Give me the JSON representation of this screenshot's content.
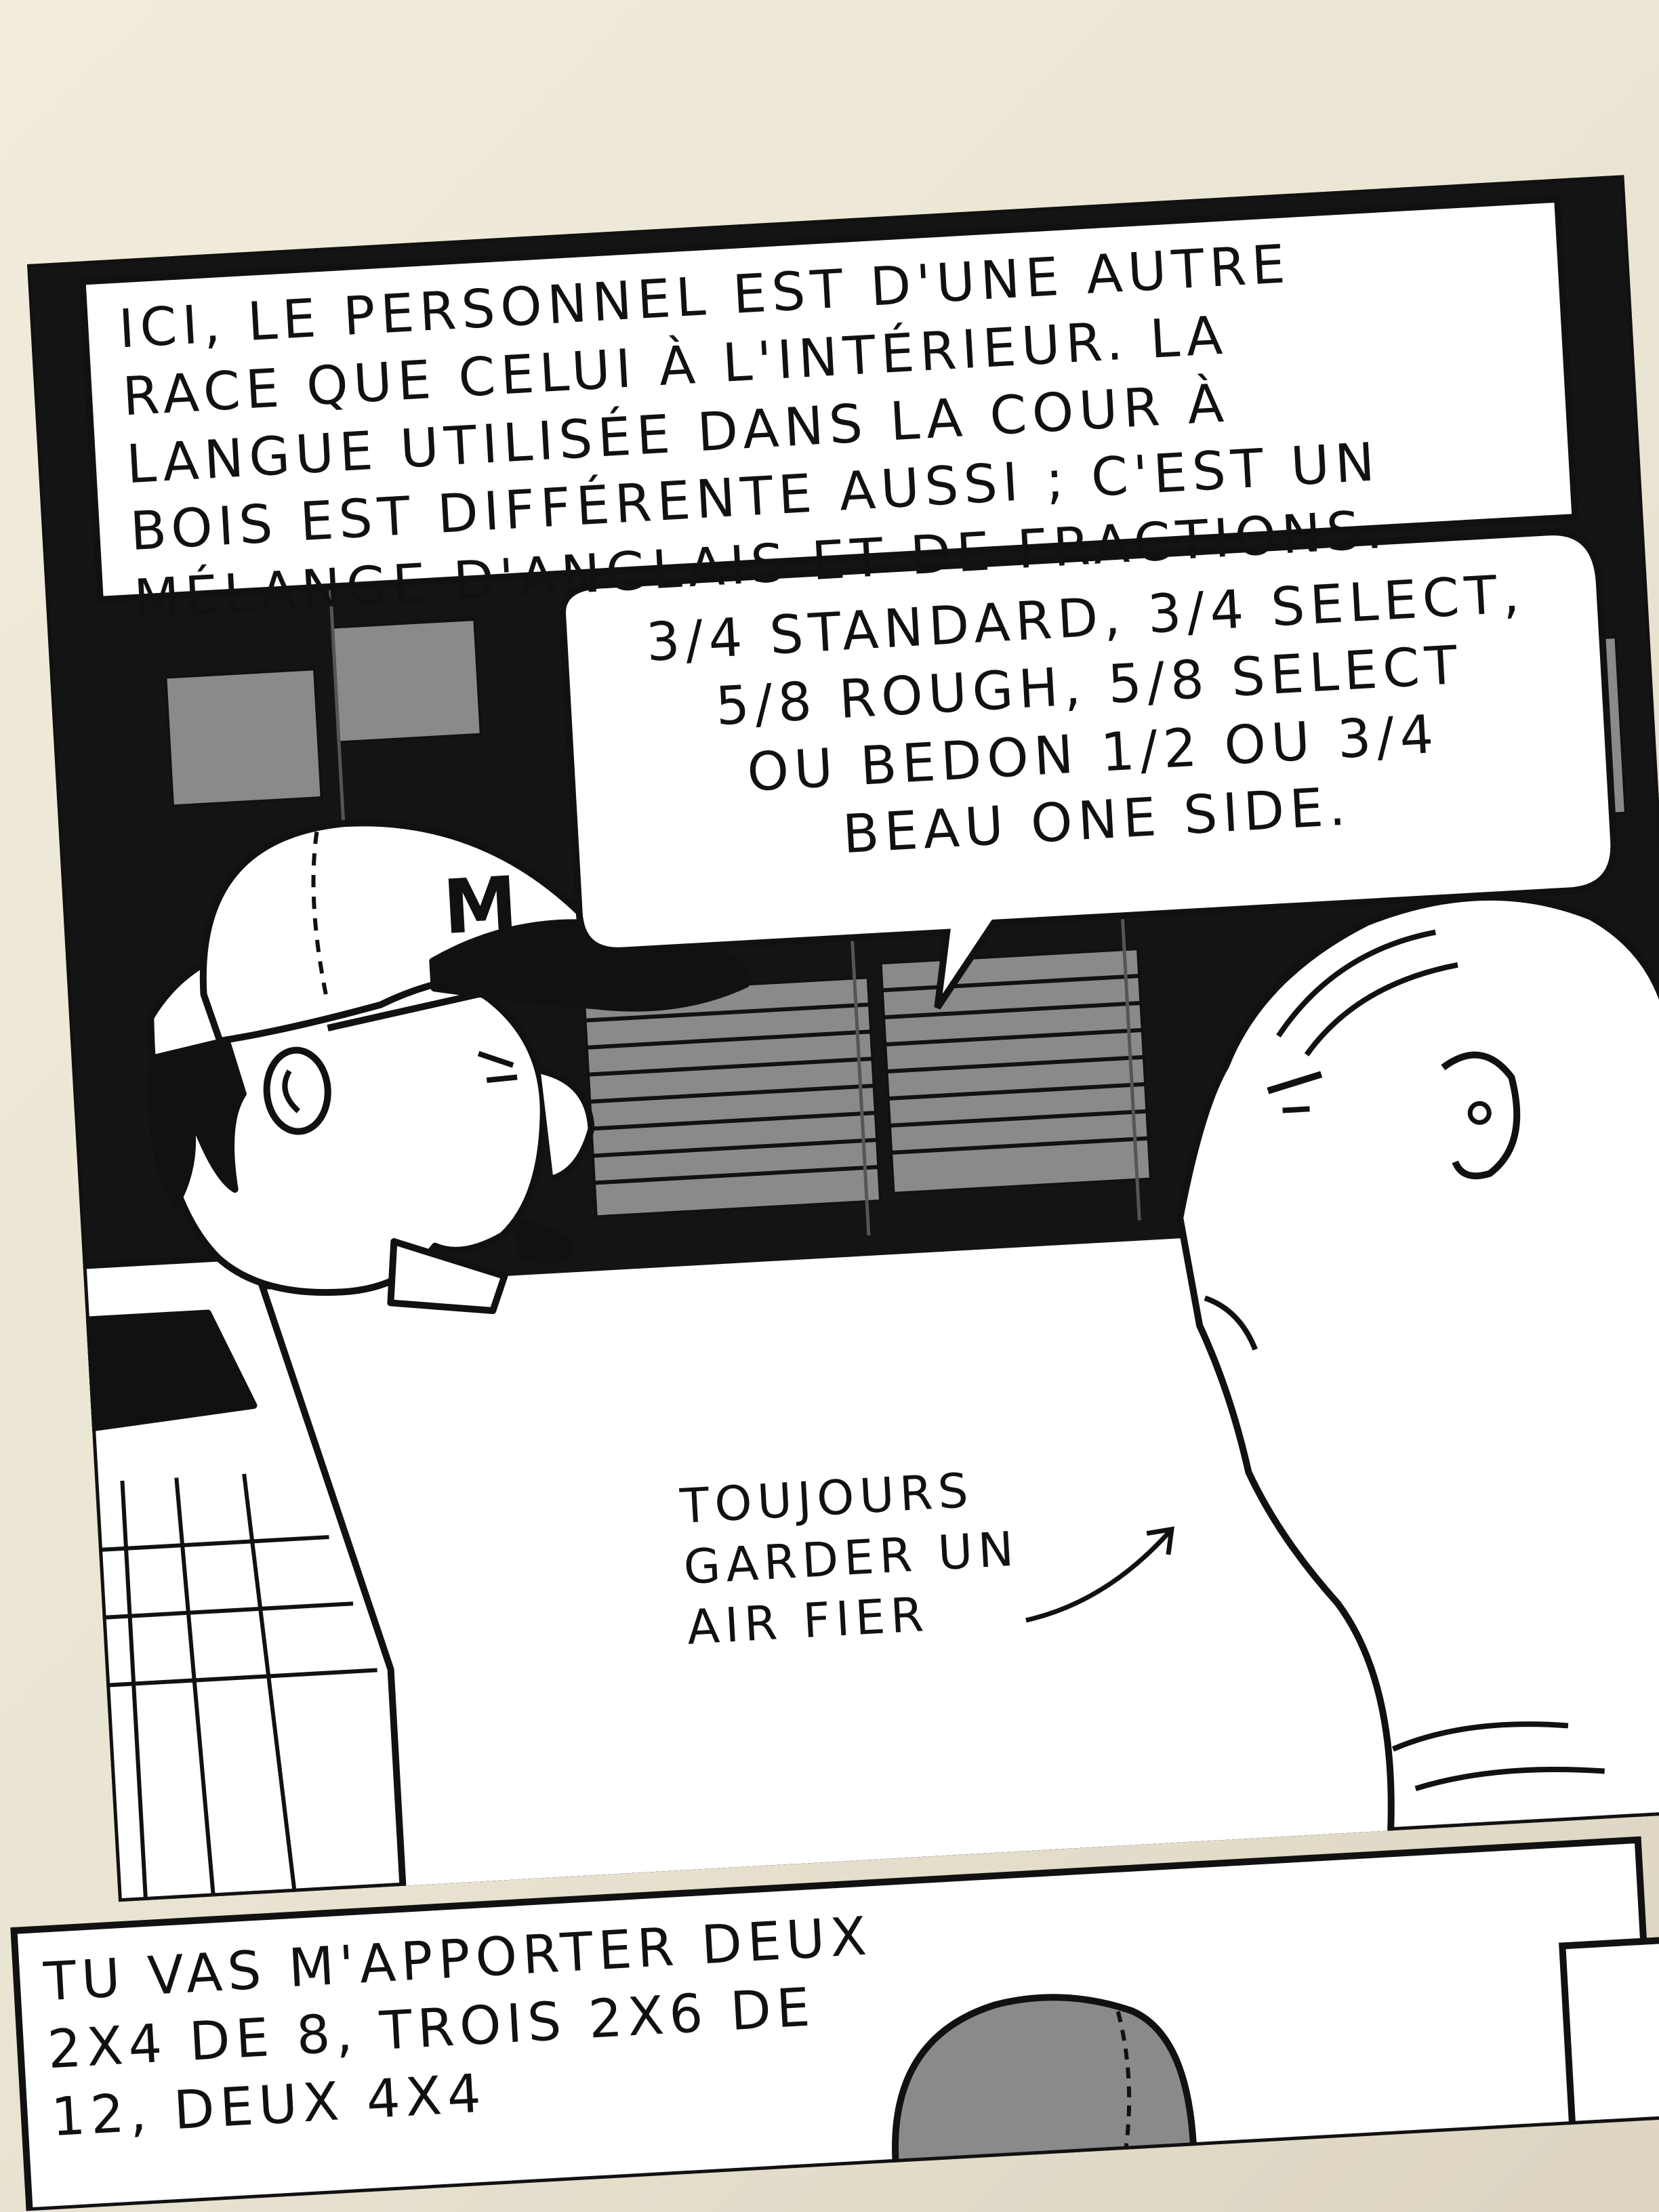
{
  "panel_1": {
    "caption": "ICI, LE PERSONNEL EST D'UNE AUTRE\nRACE QUE CELUI À L'INTÉRIEUR. LA\nLANGUE UTILISÉE DANS LA COUR À\nBOIS EST DIFFÉRENTE AUSSI ; C'EST UN\nMÉLANGE D'ANGLAIS ET DE FRACTIONS.",
    "speech_bubble": "3/4 STANDARD, 3/4 SELECT,\n5/8 ROUGH, 5/8 SELECT\nOU BEDON 1/2 OU 3/4\nBEAU ONE SIDE.",
    "cap_letter": "M",
    "annotation": "TOUJOURS\nGARDER UN\nAIR FIER"
  },
  "panel_2": {
    "caption": "TU VAS M'APPORTER DEUX\n2X4 DE 8, TROIS 2X6 DE\n12, DEUX 4X4"
  },
  "colors": {
    "paper": "#ece6d6",
    "ink": "#111111",
    "grey_screen": "#8a8a8a",
    "white": "#ffffff"
  }
}
